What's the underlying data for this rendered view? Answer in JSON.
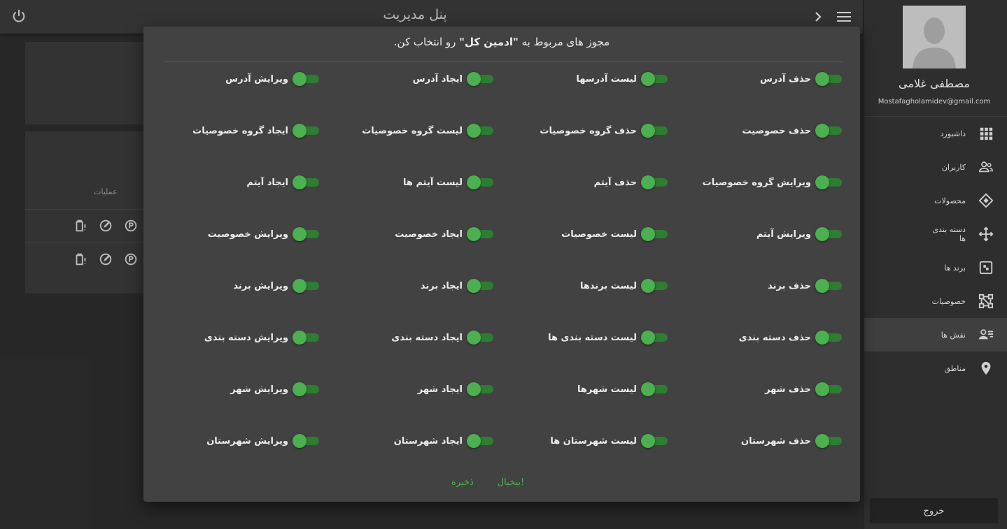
{
  "header": {
    "title": "پنل مدیریت"
  },
  "sidebar": {
    "user_name": "مصطفی غلامی",
    "user_email": "Mostafagholamidev@gmail.com",
    "items": [
      {
        "label": "داشبورد",
        "icon": "grid-icon"
      },
      {
        "label": "کاربران",
        "icon": "users-icon"
      },
      {
        "label": "محصولات",
        "icon": "product-icon"
      },
      {
        "label": "دسته بندی ها",
        "icon": "category-icon"
      },
      {
        "label": "برند ها",
        "icon": "brand-icon"
      },
      {
        "label": "خصوصیات",
        "icon": "attributes-icon"
      },
      {
        "label": "نقش ها",
        "icon": "roles-icon",
        "active": true
      },
      {
        "label": "مناطق",
        "icon": "location-pin-icon"
      }
    ],
    "logout_label": "خروج"
  },
  "background": {
    "operations_header": "عملیات"
  },
  "dialog": {
    "title_prefix": "مجوز های مربوط به ",
    "title_role": "\"ادمین کل\"",
    "title_suffix": " رو انتخاب کن.",
    "permissions": [
      [
        "حذف آدرس",
        "لیست آدرسها",
        "ایجاد آدرس",
        "ویرایش آدرس"
      ],
      [
        "حذف خصوصیت",
        "حذف گروه خصوصیات",
        "لیست گروه خصوصیات",
        "ایجاد گروه خصوصیات"
      ],
      [
        "ویرایش گروه خصوصیات",
        "حذف آیتم",
        "لیست آیتم ها",
        "ایجاد آیتم"
      ],
      [
        "ویرایش آیتم",
        "لیست خصوصیات",
        "ایجاد خصوصیت",
        "ویرایش خصوصیت"
      ],
      [
        "حذف برند",
        "لیست برندها",
        "ایجاد برند",
        "ویرایش برند"
      ],
      [
        "حذف دسته بندی",
        "لیست دسته بندی ها",
        "ایجاد دسته بندی",
        "ویرایش دسته بندی"
      ],
      [
        "حذف شهر",
        "لیست شهرها",
        "ایجاد شهر",
        "ویرایش شهر"
      ],
      [
        "حذف شهرستان",
        "لیست شهرستان ها",
        "ایجاد شهرستان",
        "ویرایش شهرستان"
      ]
    ],
    "all_enabled": true,
    "cancel_label": "بیخیال!",
    "save_label": "ذخیره"
  },
  "colors": {
    "accent": "#4caf50",
    "track": "#2e7d32",
    "dialog_bg": "#424242"
  }
}
